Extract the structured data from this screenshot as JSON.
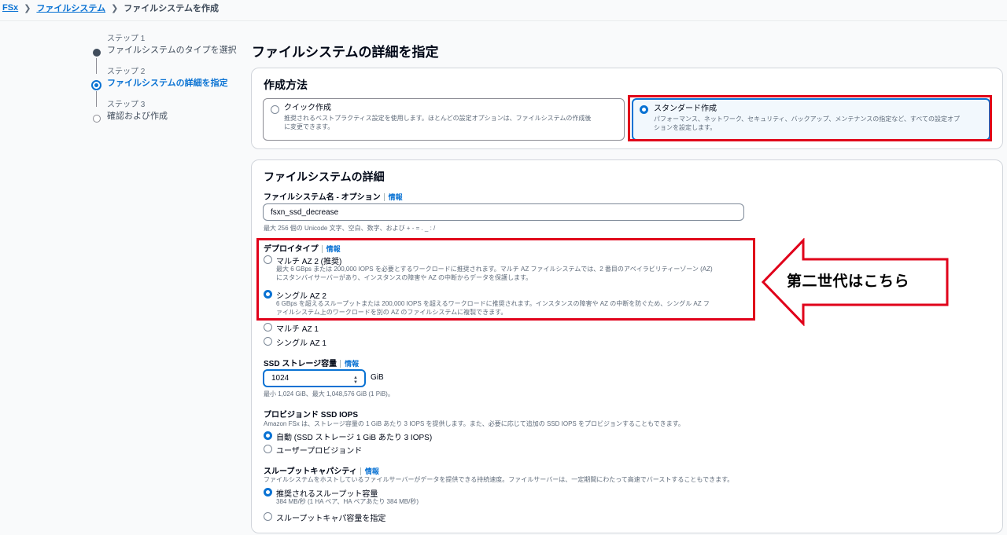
{
  "breadcrumb": {
    "root": "FSx",
    "parent": "ファイルシステム",
    "current": "ファイルシステムを作成"
  },
  "steps": [
    {
      "label": "ステップ 1",
      "name": "ファイルシステムのタイプを選択",
      "state": "done"
    },
    {
      "label": "ステップ 2",
      "name": "ファイルシステムの詳細を指定",
      "state": "current"
    },
    {
      "label": "ステップ 3",
      "name": "確認および作成",
      "state": "todo"
    }
  ],
  "page_title": "ファイルシステムの詳細を指定",
  "creation_method": {
    "title": "作成方法",
    "quick": {
      "label": "クイック作成",
      "desc1": "推奨されるベストプラクティス設定を使用します。ほとんどの設定オプションは、ファイルシステムの作成後",
      "desc2": "に変更できます。"
    },
    "standard": {
      "label": "スタンダード作成",
      "desc1": "パフォーマンス、ネットワーク、セキュリティ、バックアップ、メンテナンスの指定など、すべての設定オプ",
      "desc2": "ションを設定します。"
    },
    "selected": "standard"
  },
  "details": {
    "title": "ファイルシステムの詳細",
    "info_label": "情報",
    "name_label": "ファイルシステム名 - オプション",
    "name_value": "fsxn_ssd_decrease",
    "name_help": "最大 256 個の Unicode 文字、空白、数字、および + - = . _ : /",
    "deploy_label": "デプロイタイプ",
    "deploy_options": {
      "multi_az2": {
        "label": "マルチ AZ 2 (推奨)",
        "desc1": "最大 6 GBps または 200,000 IOPS を必要とするワークロードに推奨されます。マルチ AZ ファイルシステムでは、2 番目のアベイラビリティーゾーン (AZ)",
        "desc2": "にスタンバイサーバーがあり、インスタンスの障害や AZ の中断からデータを保護します。"
      },
      "single_az2": {
        "label": "シングル AZ 2",
        "desc1": "6 GBps を超えるスループットまたは 200,000 IOPS を超えるワークロードに推奨されます。インスタンスの障害や AZ の中断を防ぐため、シングル AZ フ",
        "desc2": "ァイルシステム上のワークロードを別の AZ のファイルシステムに複製できます。"
      },
      "multi_az1": {
        "label": "マルチ AZ 1"
      },
      "single_az1": {
        "label": "シングル AZ 1"
      },
      "selected": "single_az2"
    },
    "ssd_label": "SSD ストレージ容量",
    "ssd_value": "1024",
    "ssd_unit": "GiB",
    "ssd_help": "最小 1,024 GiB、最大 1,048,576 GiB (1 PiB)。",
    "iops_label": "プロビジョンド SSD IOPS",
    "iops_help": "Amazon FSx は、ストレージ容量の 1 GiB あたり 3 IOPS を提供します。また、必要に応じて追加の SSD IOPS をプロビジョンすることもできます。",
    "iops_auto": "自動 (SSD ストレージ 1 GiB あたり 3 IOPS)",
    "iops_user": "ユーザープロビジョンド",
    "throughput_label": "スループットキャパシティ",
    "throughput_help": "ファイルシステムをホストしているファイルサーバーがデータを提供できる持続速度。ファイルサーバーは、一定期間にわたって高速でバーストすることもできます。",
    "throughput_recommended": "推奨されるスループット容量",
    "throughput_recommended_desc": "384 MB/秒 (1 HA ペア、HA ペアあたり 384 MB/秒)",
    "throughput_specify": "スループットキャパ容量を指定"
  },
  "annotation": {
    "callout_text": "第二世代はこちら"
  },
  "colors": {
    "accent": "#0972d3",
    "highlight": "#e0001a"
  }
}
